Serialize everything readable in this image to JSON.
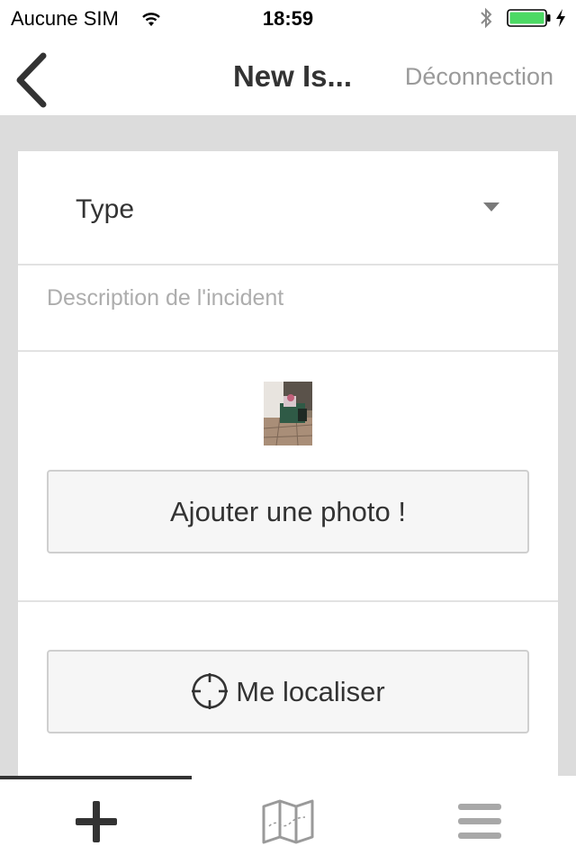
{
  "status_bar": {
    "carrier": "Aucune SIM",
    "time": "18:59",
    "battery_color": "#4cd964"
  },
  "nav": {
    "back_icon": "chevron-left-icon",
    "title": "New Is...",
    "logout": "Déconnection"
  },
  "form": {
    "type_label": "Type",
    "description_placeholder": "Description de l'incident",
    "add_photo_label": "Ajouter une photo !",
    "locate_label": "Me localiser",
    "locate_icon": "crosshair-icon"
  },
  "tabs": [
    {
      "icon": "plus-icon",
      "selected": true
    },
    {
      "icon": "map-icon",
      "selected": false
    },
    {
      "icon": "menu-icon",
      "selected": false
    }
  ],
  "colors": {
    "background": "#dcdcdc",
    "text": "#333333",
    "muted": "#9a9a9a"
  }
}
